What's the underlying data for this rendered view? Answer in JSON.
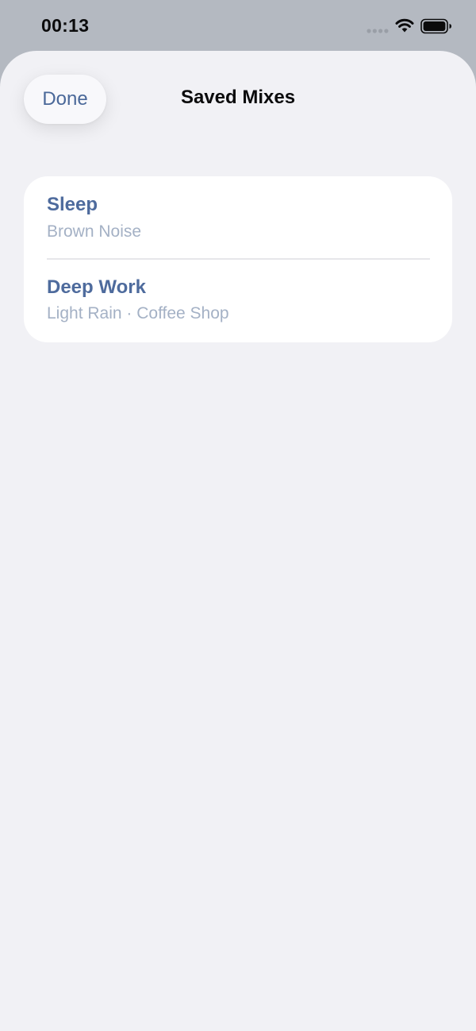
{
  "status_bar": {
    "time": "00:13"
  },
  "sheet": {
    "title": "Saved Mixes",
    "done_label": "Done"
  },
  "mixes": [
    {
      "name": "Sleep",
      "sounds": "Brown Noise"
    },
    {
      "name": "Deep Work",
      "sounds": "Light Rain · Coffee Shop"
    }
  ],
  "colors": {
    "accent": "#4e6b9d",
    "subtitle": "#a4b1c5",
    "sheet_background": "#f1f1f5",
    "backdrop": "#b4b9c1"
  },
  "icons": {
    "signal": "signal-dots-icon",
    "wifi": "wifi-icon",
    "battery": "battery-icon"
  }
}
